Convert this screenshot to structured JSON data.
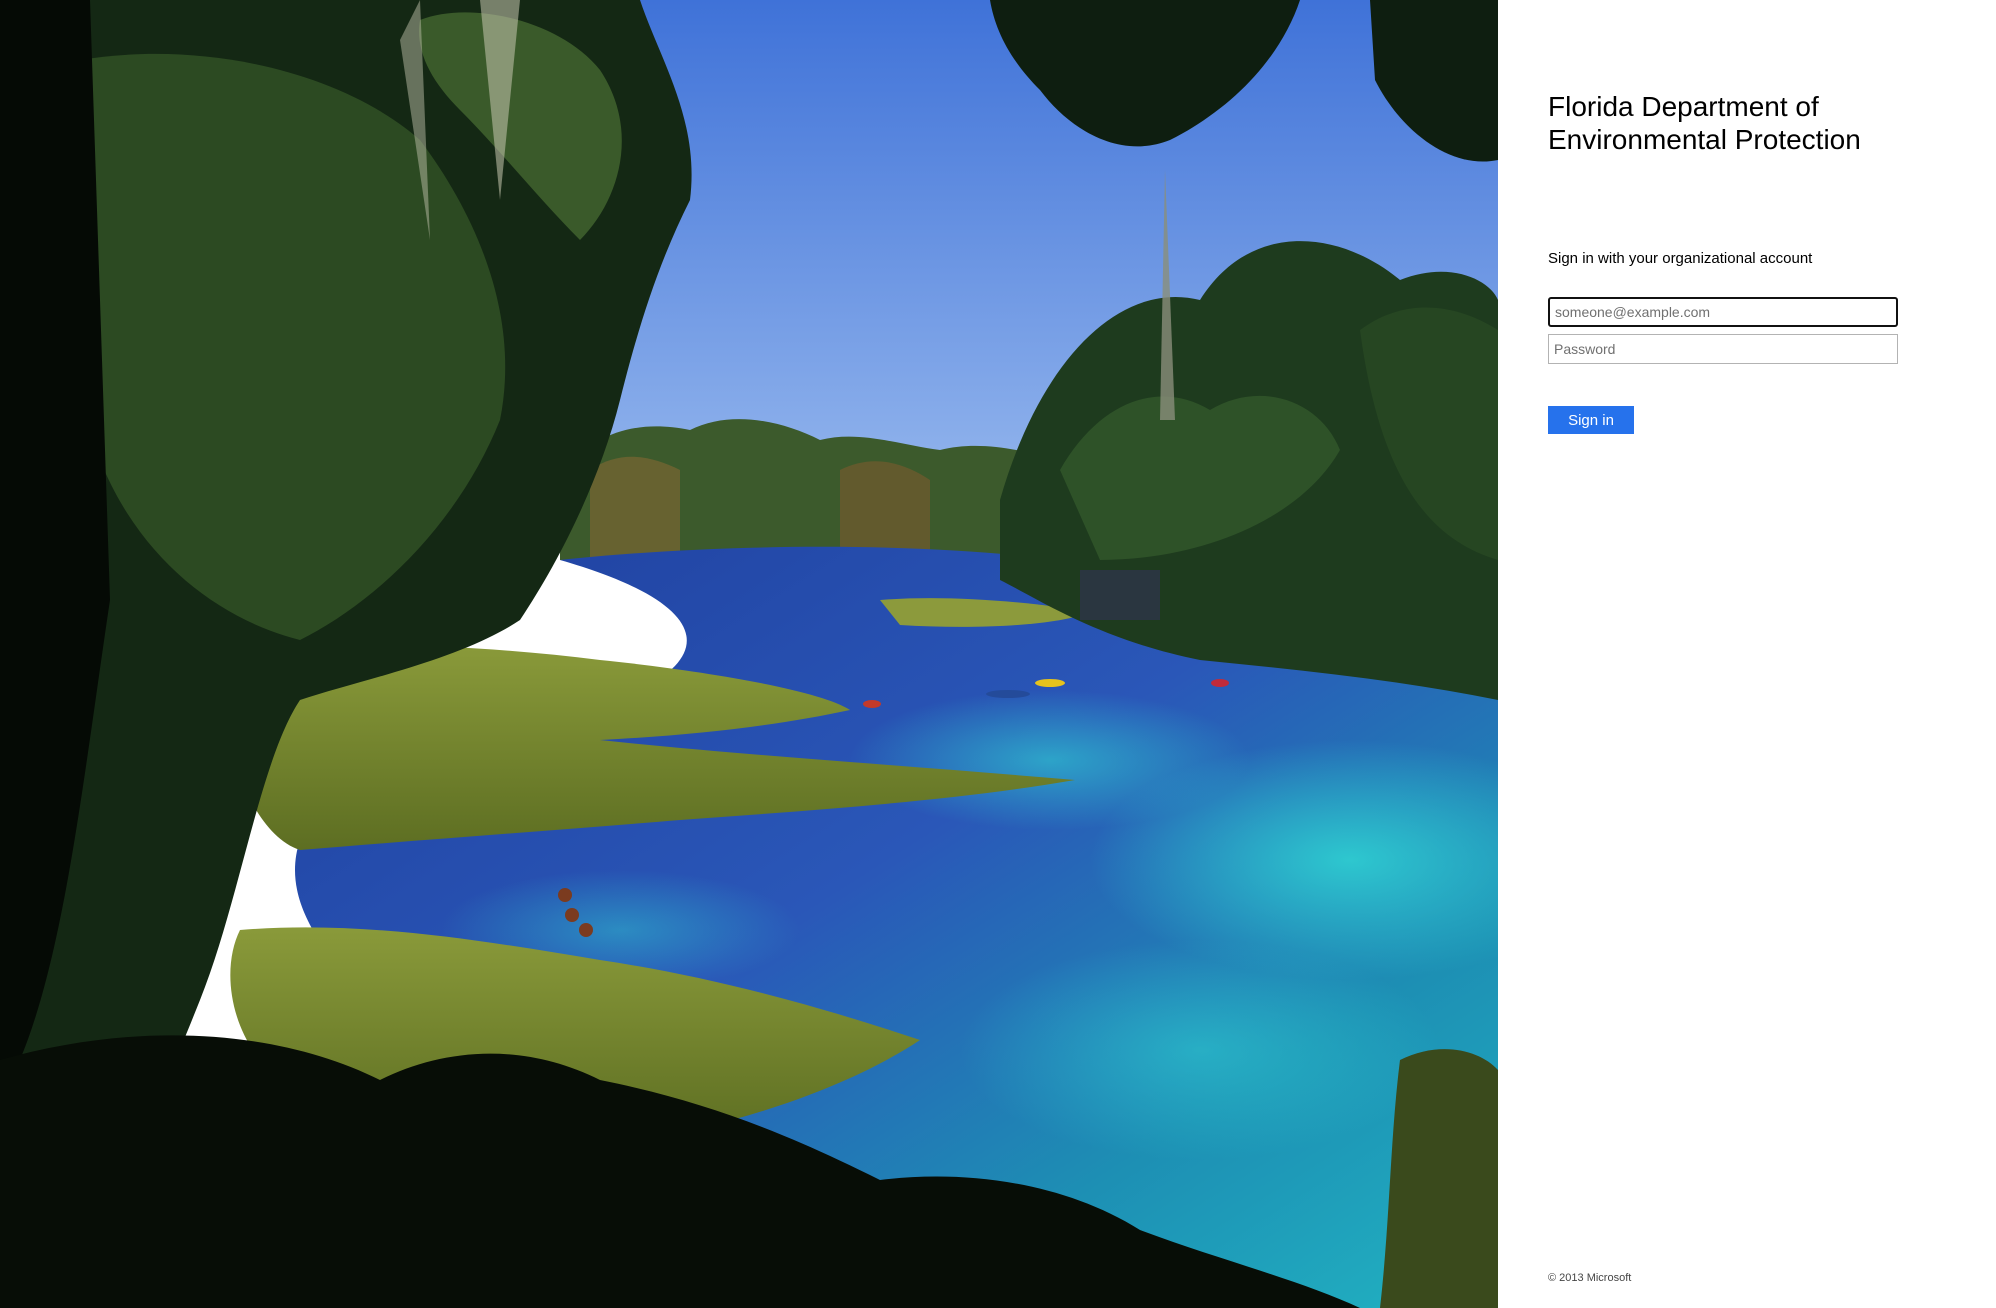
{
  "organization": {
    "title": "Florida Department of Environmental Protection"
  },
  "login": {
    "intro": "Sign in with your organizational account",
    "username_placeholder": "someone@example.com",
    "username_value": "",
    "password_placeholder": "Password",
    "password_value": "",
    "submit_label": "Sign in"
  },
  "footer": {
    "copyright": "© 2013 Microsoft"
  },
  "colors": {
    "accent": "#2672ec",
    "panel_background": "#ffffff"
  }
}
